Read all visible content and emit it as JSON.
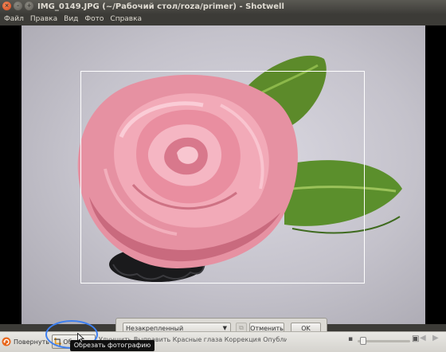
{
  "window": {
    "title": "IMG_0149.JPG (~/Рабочий стол/roza/primer) - Shotwell"
  },
  "menubar": {
    "items": [
      "Файл",
      "Правка",
      "Вид",
      "Фото",
      "Справка"
    ]
  },
  "crop_panel": {
    "constraint_value": "Незакрепленный",
    "cancel_label": "Отменить",
    "ok_label": "OK"
  },
  "toolbar": {
    "rotate_label": "Повернуть",
    "crop_label": "Обрезать",
    "hidden_buttons_text": "Улучшить  Выправить  Красные глаза  Коррекция  Опубликовать"
  },
  "tooltip": {
    "text": "Обрезать фотографию"
  },
  "zoom": {
    "level_fraction": 0.05
  },
  "colors": {
    "highlight": "#3d7ff0",
    "rotate_icon": "#e8661c",
    "crop_icon": "#e6a12a"
  }
}
